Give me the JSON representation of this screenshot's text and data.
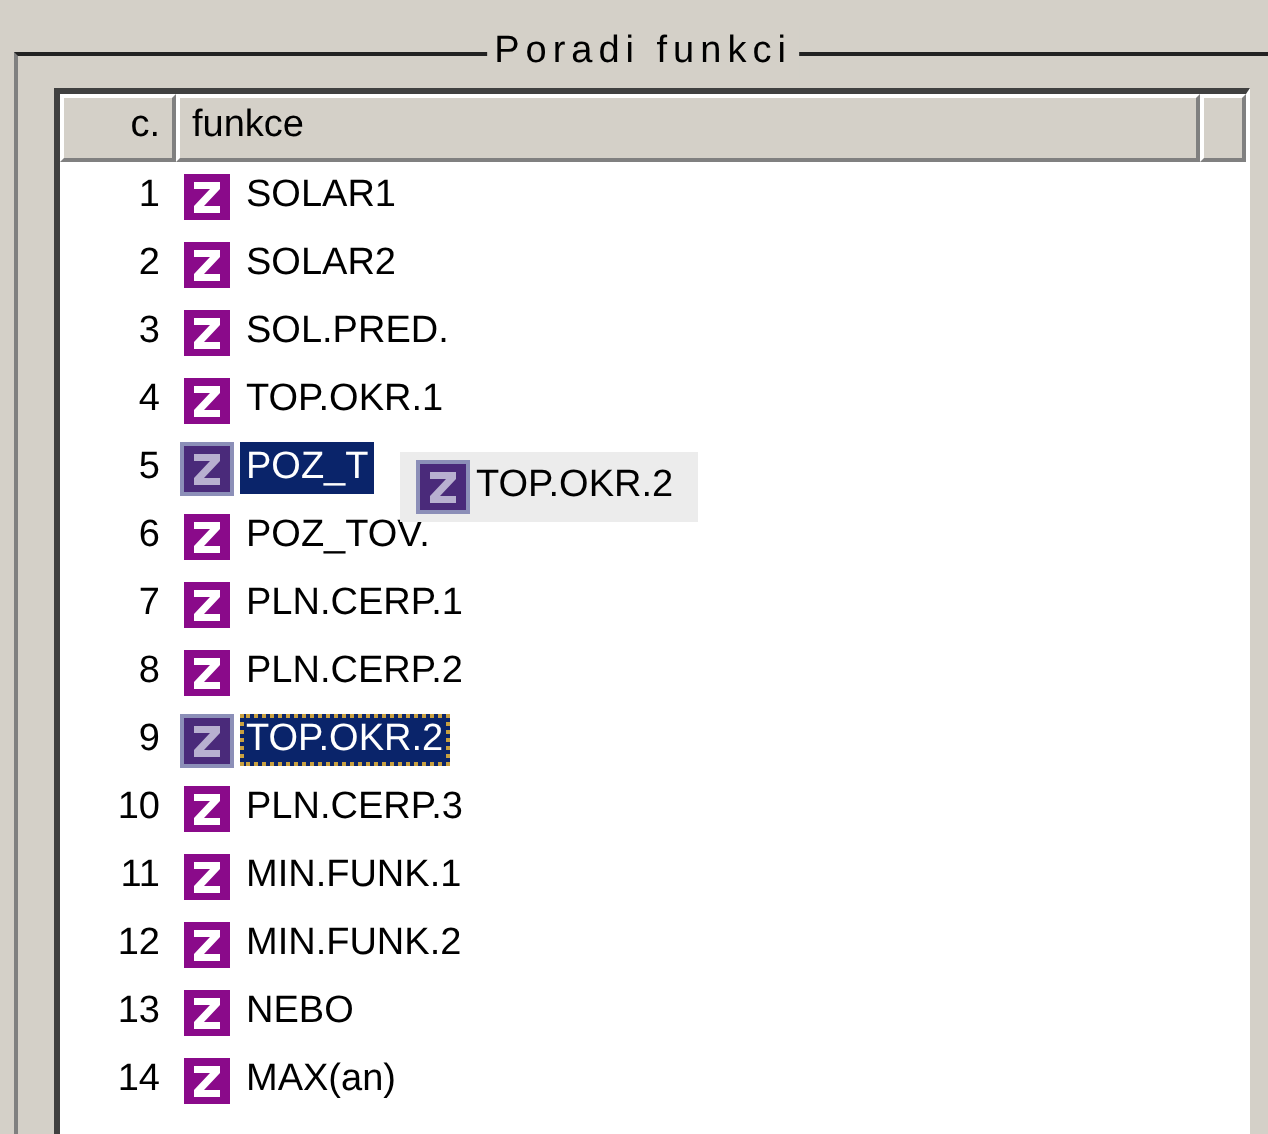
{
  "group": {
    "title": "Poradi funkci"
  },
  "columns": [
    "c.",
    "funkce"
  ],
  "rows": [
    {
      "number": "1",
      "label": "SOLAR1",
      "selected": false,
      "focused": false
    },
    {
      "number": "2",
      "label": "SOLAR2",
      "selected": false,
      "focused": false
    },
    {
      "number": "3",
      "label": "SOL.PRED.",
      "selected": false,
      "focused": false
    },
    {
      "number": "4",
      "label": "TOP.OKR.1",
      "selected": false,
      "focused": false
    },
    {
      "number": "5",
      "label": "POZ_T",
      "selected": true,
      "focused": false
    },
    {
      "number": "6",
      "label": "POZ_TOV.",
      "selected": false,
      "focused": false
    },
    {
      "number": "7",
      "label": "PLN.CERP.1",
      "selected": false,
      "focused": false
    },
    {
      "number": "8",
      "label": "PLN.CERP.2",
      "selected": false,
      "focused": false
    },
    {
      "number": "9",
      "label": "TOP.OKR.2",
      "selected": true,
      "focused": true
    },
    {
      "number": "10",
      "label": "PLN.CERP.3",
      "selected": false,
      "focused": false
    },
    {
      "number": "11",
      "label": "MIN.FUNK.1",
      "selected": false,
      "focused": false
    },
    {
      "number": "12",
      "label": "MIN.FUNK.2",
      "selected": false,
      "focused": false
    },
    {
      "number": "13",
      "label": "NEBO",
      "selected": false,
      "focused": false
    },
    {
      "number": "14",
      "label": "MAX(an)",
      "selected": false,
      "focused": false
    }
  ],
  "drag_ghost": {
    "label": "TOP.OKR.2"
  }
}
